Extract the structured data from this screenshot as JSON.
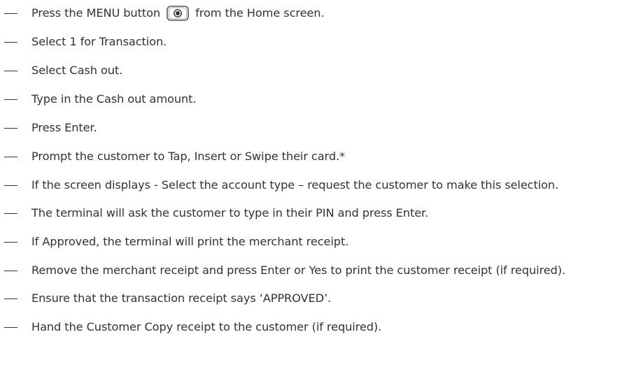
{
  "steps": [
    {
      "before_icon": "Press the MENU button",
      "icon": "menu-button-icon",
      "after_icon": "from the Home screen."
    },
    {
      "text": "Select 1 for Transaction."
    },
    {
      "text": "Select Cash out."
    },
    {
      "text": "Type in the Cash out amount."
    },
    {
      "text": "Press Enter."
    },
    {
      "text": "Prompt the customer to Tap, Insert or Swipe their card.*"
    },
    {
      "text": "If the screen displays - Select the account type – request the customer to make this selection."
    },
    {
      "text": "The terminal will ask the customer to type in their PIN and press Enter."
    },
    {
      "text": "If Approved, the terminal will print the merchant receipt."
    },
    {
      "text": "Remove the merchant receipt and press Enter or Yes to print the customer receipt (if required)."
    },
    {
      "text": "Ensure that the transaction receipt says ‘APPROVED’."
    },
    {
      "text": "Hand the Customer Copy receipt to the customer (if required)."
    }
  ],
  "colors": {
    "text": "#333333",
    "icon_stroke": "#555555"
  }
}
